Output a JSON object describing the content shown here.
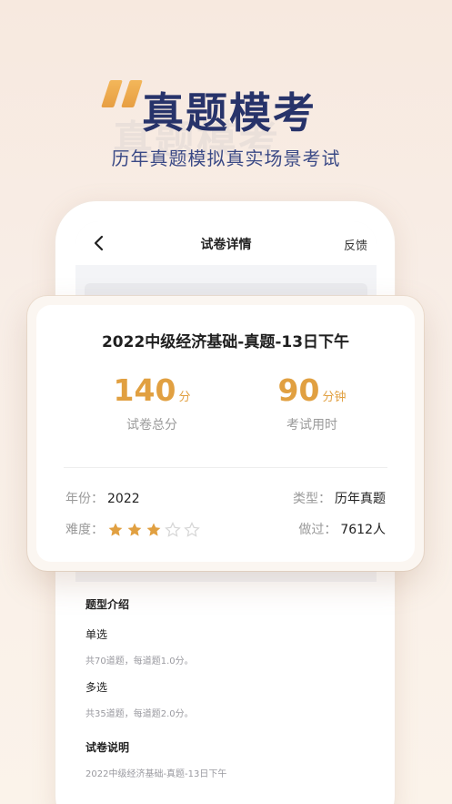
{
  "hero": {
    "title": "真题模考",
    "subtitle": "历年真题模拟真实场景考试"
  },
  "topbar": {
    "title": "试卷详情",
    "feedback": "反馈"
  },
  "exam": {
    "title": "2022中级经济基础-真题-13日下午",
    "total_score": "140",
    "total_score_unit": "分",
    "total_score_label": "试卷总分",
    "time": "90",
    "time_unit": "分钟",
    "time_label": "考试用时",
    "year_label": "年份：",
    "year": "2022",
    "type_label": "类型：",
    "type": "历年真题",
    "difficulty_label": "难度：",
    "difficulty_stars": 3,
    "difficulty_max": 5,
    "done_label": "做过：",
    "done_count": "7612人"
  },
  "intro": {
    "section_title": "题型介绍",
    "single_title": "单选",
    "single_desc": "共70道题，每道题1.0分。",
    "multi_title": "多选",
    "multi_desc": "共35道题，每道题2.0分。",
    "notes_title": "试卷说明",
    "notes_desc": "2022中级经济基础-真题-13日下午"
  },
  "colors": {
    "accent": "#e1a041",
    "title_navy": "#27336a",
    "star_empty": "#d6d6d6"
  }
}
